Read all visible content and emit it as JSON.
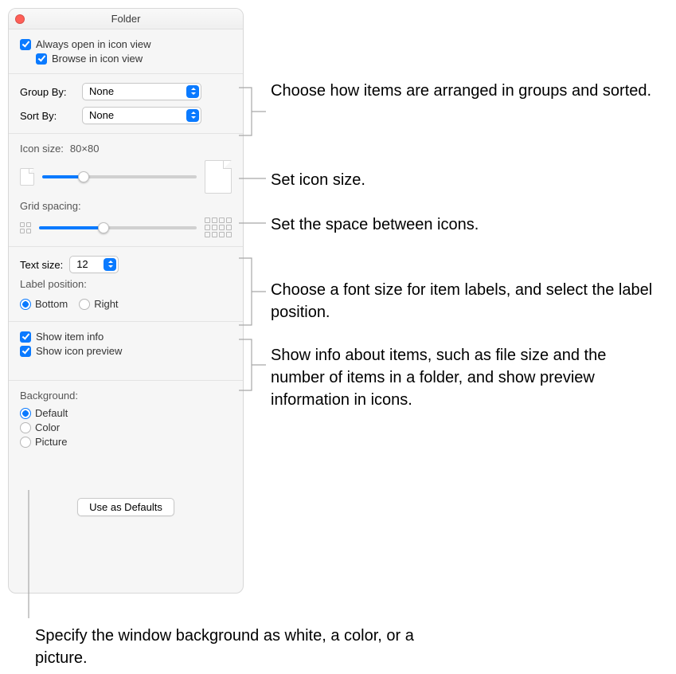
{
  "window": {
    "title": "Folder"
  },
  "viewOptions": {
    "alwaysOpen": "Always open in icon view",
    "browse": "Browse in icon view"
  },
  "arrange": {
    "groupByLabel": "Group By:",
    "groupByValue": "None",
    "sortByLabel": "Sort By:",
    "sortByValue": "None"
  },
  "iconSize": {
    "label": "Icon size:",
    "value": "80×80"
  },
  "gridSpacing": {
    "label": "Grid spacing:"
  },
  "text": {
    "sizeLabel": "Text size:",
    "sizeValue": "12",
    "positionLabel": "Label position:",
    "bottom": "Bottom",
    "right": "Right"
  },
  "show": {
    "itemInfo": "Show item info",
    "iconPreview": "Show icon preview"
  },
  "background": {
    "label": "Background:",
    "default": "Default",
    "color": "Color",
    "picture": "Picture"
  },
  "buttons": {
    "useAsDefaults": "Use as Defaults"
  },
  "callouts": {
    "arrange": "Choose how items are arranged in groups and sorted.",
    "iconSize": "Set icon size.",
    "gridSpacing": "Set the space between icons.",
    "text": "Choose a font size for item labels, and select the label position.",
    "show": "Show info about items, such as file size and the number of items in a folder, and show preview information in icons.",
    "background": "Specify the window background as white, a color, or a picture."
  }
}
